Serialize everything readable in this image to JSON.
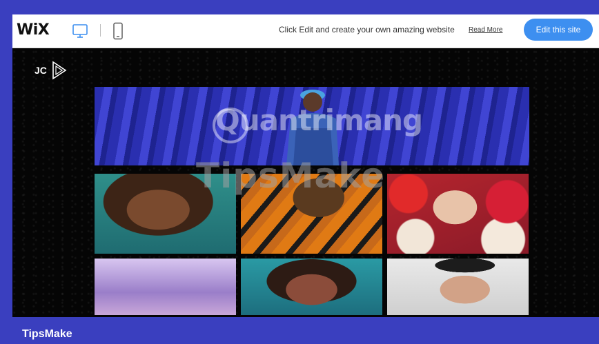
{
  "wix_bar": {
    "logo": "WiX",
    "promo_text": "Click Edit and create your own amazing website",
    "read_more": "Read More",
    "edit_button": "Edit this site",
    "accent_color": "#3d8ff0",
    "icons": [
      "desktop-icon",
      "mobile-icon"
    ]
  },
  "site": {
    "logo_text": "JC",
    "logo_icon": "play-icon",
    "hero": "man-in-cap-against-blue-wall",
    "photos": [
      "woman-curly-hair-teal-background",
      "man-orange-patterned-shirt",
      "woman-among-red-roses",
      "blurred-purple-portrait",
      "woman-curly-hair-visor",
      "man-round-sunglasses-beanie"
    ]
  },
  "watermarks": {
    "top": "Quantrimang",
    "middle": "TipsMake"
  },
  "footer": {
    "brand": "TipsMake"
  }
}
